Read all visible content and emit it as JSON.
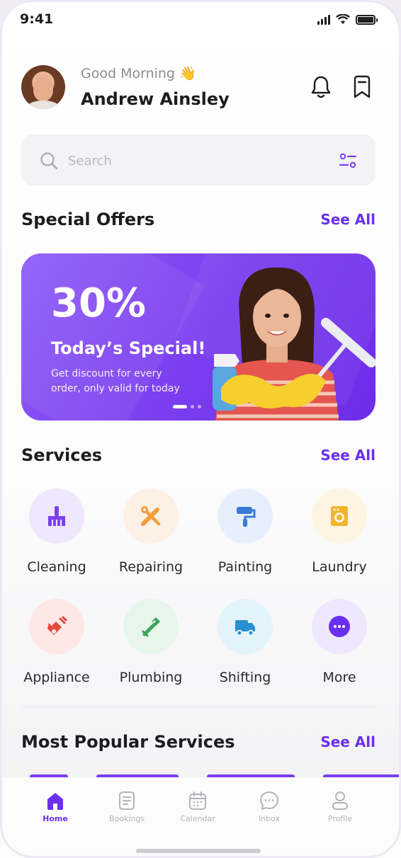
{
  "status": {
    "time": "9:41"
  },
  "header": {
    "greeting": "Good Morning 👋",
    "user_name": "Andrew Ainsley"
  },
  "search": {
    "placeholder": "Search"
  },
  "special_offers": {
    "title": "Special Offers",
    "see_all": "See All",
    "banner": {
      "percent": "30%",
      "title": "Today’s Special!",
      "description": "Get discount for every order, only valid for today"
    }
  },
  "services": {
    "title": "Services",
    "see_all": "See All",
    "items": [
      {
        "label": "Cleaning",
        "icon": "broom-icon",
        "bg": "#efe7fd",
        "color": "#7b3ff0"
      },
      {
        "label": "Repairing",
        "icon": "tools-icon",
        "bg": "#fdf0e4",
        "color": "#f39c3c"
      },
      {
        "label": "Painting",
        "icon": "paint-roller-icon",
        "bg": "#e8effc",
        "color": "#3a7bd5"
      },
      {
        "label": "Laundry",
        "icon": "washing-machine-icon",
        "bg": "#fdf4e2",
        "color": "#f2b52a"
      },
      {
        "label": "Appliance",
        "icon": "appliance-icon",
        "bg": "#fde8e6",
        "color": "#e5483b"
      },
      {
        "label": "Plumbing",
        "icon": "wrench-icon",
        "bg": "#e6f6ea",
        "color": "#3aa35a"
      },
      {
        "label": "Shifting",
        "icon": "truck-icon",
        "bg": "#e3f3fb",
        "color": "#2a8fd0"
      },
      {
        "label": "More",
        "icon": "more-icon",
        "bg": "#efe7fd",
        "color": "#6a2ff0"
      }
    ]
  },
  "popular": {
    "title": "Most Popular Services",
    "see_all": "See All"
  },
  "nav": {
    "items": [
      {
        "label": "Home",
        "icon": "home-icon",
        "active": true
      },
      {
        "label": "Bookings",
        "icon": "bookings-icon",
        "active": false
      },
      {
        "label": "Calendar",
        "icon": "calendar-icon",
        "active": false
      },
      {
        "label": "Inbox",
        "icon": "inbox-icon",
        "active": false
      },
      {
        "label": "Profile",
        "icon": "profile-icon",
        "active": false
      }
    ]
  },
  "colors": {
    "accent": "#6a2ff0",
    "banner": "#7b3ff0",
    "text": "#1d1d1f"
  }
}
